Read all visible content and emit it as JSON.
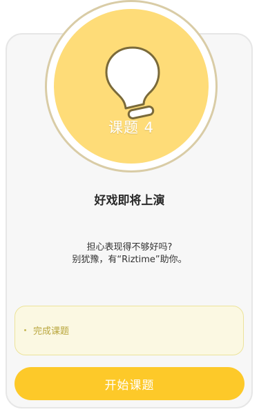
{
  "badge": {
    "icon": "lightbulb-icon",
    "label": "课题 4"
  },
  "main": {
    "heading": "好戏即将上演",
    "desc_line1": "担心表现得不够好吗?",
    "desc_line2": "别犹豫，有“Riztime”助你。"
  },
  "task": {
    "label": "完成课题"
  },
  "actions": {
    "start_label": "开始课题"
  },
  "colors": {
    "badge_fill": "#fedc78",
    "accent": "#fdc929",
    "task_bg": "#fbf8e2",
    "task_text": "#b9a63d"
  }
}
